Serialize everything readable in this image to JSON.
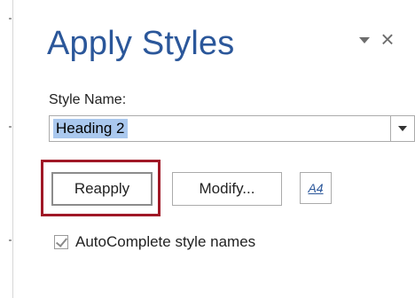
{
  "pane": {
    "title": "Apply Styles",
    "menu_icon": "triangle-down-icon",
    "close_glyph": "×"
  },
  "style_name": {
    "label": "Style Name:",
    "value": "Heading 2",
    "selected": true
  },
  "buttons": {
    "reapply": "Reapply",
    "modify": "Modify...",
    "styles_icon": "A4"
  },
  "autocomplete": {
    "label": "AutoComplete style names",
    "checked": true
  },
  "colors": {
    "title": "#2b579a",
    "highlight_border": "#a01826",
    "selection": "#aac8ee"
  }
}
